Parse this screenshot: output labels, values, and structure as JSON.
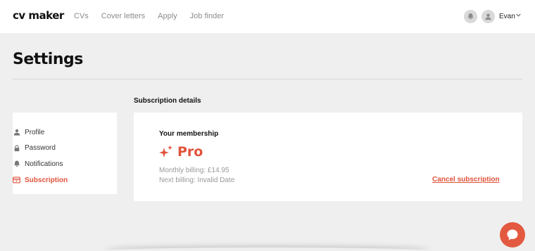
{
  "brand": {
    "logo_text": "cv maker",
    "accent": "#e0533b"
  },
  "nav": {
    "items": [
      {
        "label": "CVs"
      },
      {
        "label": "Cover letters"
      },
      {
        "label": "Apply"
      },
      {
        "label": "Job finder"
      }
    ]
  },
  "user": {
    "name": "Evan",
    "avatar_icon": "user-icon",
    "notify_icon": "bell-icon"
  },
  "page": {
    "title": "Settings"
  },
  "sidebar": {
    "items": [
      {
        "label": "Profile",
        "icon": "user-icon",
        "active": false
      },
      {
        "label": "Password",
        "icon": "lock-icon",
        "active": false
      },
      {
        "label": "Notifications",
        "icon": "bell-icon",
        "active": false
      },
      {
        "label": "Subscription",
        "icon": "card-icon",
        "active": true
      }
    ]
  },
  "subscription": {
    "section_title": "Subscription details",
    "membership_label": "Your membership",
    "plan_icon": "sparkle-icon",
    "plan_name": "Pro",
    "monthly_billing": "Monthly billing: £14.95",
    "next_billing": "Next billing: Invalid Date",
    "cancel_label": "Cancel subscription"
  },
  "chat": {
    "icon": "chat-bubble-icon"
  }
}
